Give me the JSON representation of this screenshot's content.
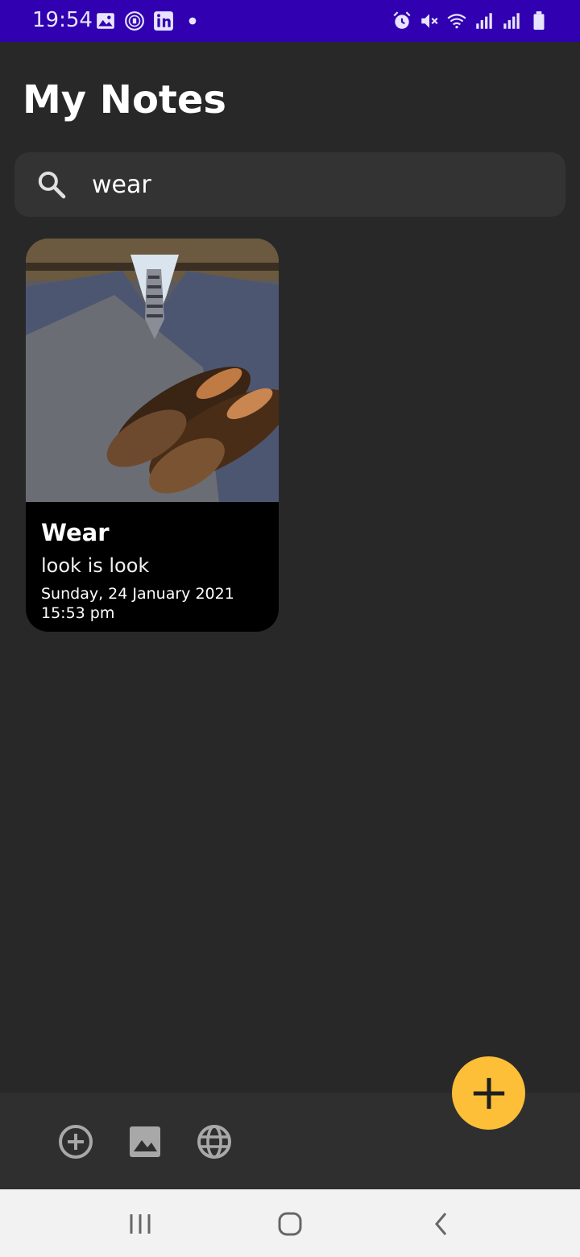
{
  "status_bar": {
    "time": "19:54",
    "left_icons": [
      "image-icon",
      "manchester-united-crest-icon",
      "linkedin-icon",
      "dot-icon"
    ],
    "right_icons": [
      "alarm-icon",
      "mute-icon",
      "wifi-icon",
      "signal-icon",
      "signal-icon",
      "battery-icon"
    ]
  },
  "header": {
    "title": "My Notes"
  },
  "search": {
    "value": "wear",
    "placeholder": ""
  },
  "notes": [
    {
      "title": "Wear",
      "subtitle": "look is look",
      "date": "Sunday, 24 January 2021 15:53 pm",
      "image": "suit-and-shoes-photo"
    }
  ],
  "bottom_bar": {
    "icons": [
      "add-circle-icon",
      "image-icon",
      "web-icon"
    ]
  },
  "fab": {
    "icon": "plus-icon"
  },
  "navigation": {
    "buttons": [
      "recents-icon",
      "home-icon",
      "back-icon"
    ]
  },
  "colors": {
    "status_bar": "#3100b0",
    "background": "#282828",
    "search_bar": "#333333",
    "accent": "#fdbe38",
    "card": "#000000"
  }
}
